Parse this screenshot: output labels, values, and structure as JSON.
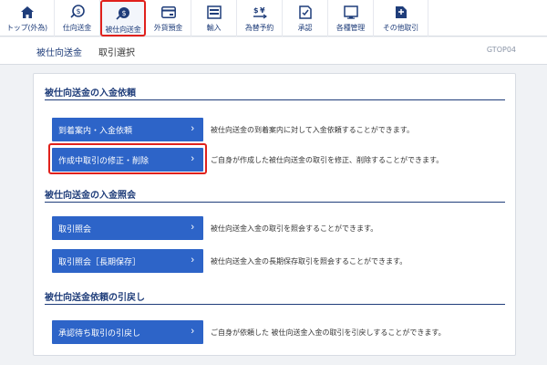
{
  "nav": {
    "items": [
      {
        "label": "トップ(外為)",
        "icon": "home-icon"
      },
      {
        "label": "仕向送金",
        "icon": "send-money-icon"
      },
      {
        "label": "被仕向送金",
        "icon": "receive-money-icon",
        "active": true
      },
      {
        "label": "外貨預金",
        "icon": "deposit-card-icon"
      },
      {
        "label": "輸入",
        "icon": "import-icon"
      },
      {
        "label": "為替予約",
        "icon": "exchange-reservation-icon"
      },
      {
        "label": "承認",
        "icon": "approval-icon"
      },
      {
        "label": "各種管理",
        "icon": "management-icon"
      },
      {
        "label": "その他取引",
        "icon": "other-transactions-icon"
      }
    ]
  },
  "page": {
    "breadcrumb_section": "被仕向送金",
    "breadcrumb_page": "取引選択",
    "screen_code": "GTOP04"
  },
  "sections": {
    "request": {
      "title": "被仕向送金の入金依頼",
      "actions": [
        {
          "label": "到着案内・入金依頼",
          "desc": "被仕向送金の到着案内に対して入金依頼することができます。"
        },
        {
          "label": "作成中取引の修正・削除",
          "desc": "ご自身が作成した被仕向送金の取引を修正、削除することができます。"
        }
      ]
    },
    "inquiry": {
      "title": "被仕向送金の入金照会",
      "actions": [
        {
          "label": "取引照会",
          "desc": "被仕向送金入金の取引を照会することができます。"
        },
        {
          "label": "取引照会［長期保存］",
          "desc": "被仕向送金入金の長期保存取引を照会することができます。"
        }
      ]
    },
    "withdraw": {
      "title": "被仕向送金依頼の引戻し",
      "actions": [
        {
          "label": "承認待ち取引の引戻し",
          "desc": "ご自身が依頼した 被仕向送金入金の取引を引戻しすることができます。"
        }
      ]
    }
  },
  "colors": {
    "primary": "#2d64c8",
    "navy": "#1f3d7a",
    "highlight": "#e0211c"
  }
}
